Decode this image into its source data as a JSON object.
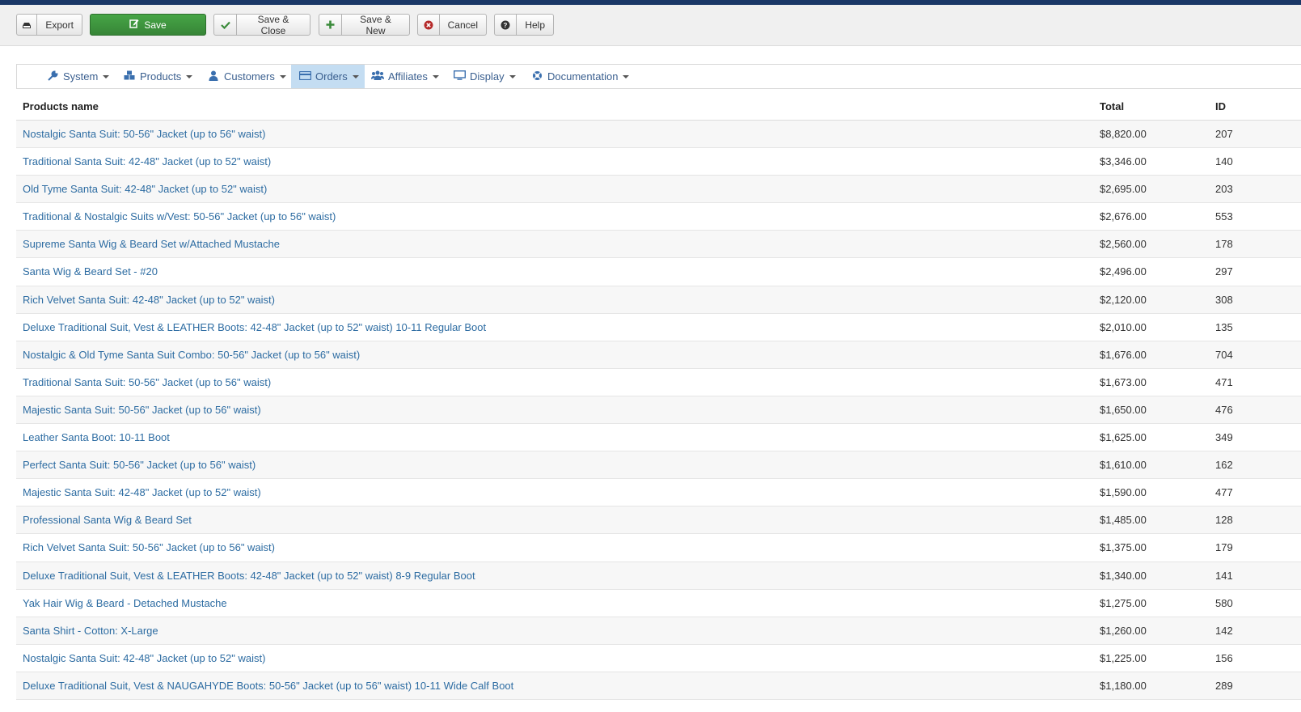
{
  "toolbar": {
    "export": "Export",
    "save": "Save",
    "save_close": "Save & Close",
    "save_new": "Save & New",
    "cancel": "Cancel",
    "help": "Help"
  },
  "menu": {
    "items": [
      {
        "label": "System",
        "icon": "wrench-icon"
      },
      {
        "label": "Products",
        "icon": "cubes-icon"
      },
      {
        "label": "Customers",
        "icon": "user-icon"
      },
      {
        "label": "Orders",
        "icon": "credit-card-icon",
        "active": true
      },
      {
        "label": "Affiliates",
        "icon": "users-icon"
      },
      {
        "label": "Display",
        "icon": "monitor-icon"
      },
      {
        "label": "Documentation",
        "icon": "lifebuoy-icon"
      }
    ]
  },
  "table": {
    "headers": {
      "name": "Products name",
      "total": "Total",
      "id": "ID"
    },
    "rows": [
      {
        "name": "Nostalgic Santa Suit: 50-56\" Jacket (up to 56\" waist)",
        "total": "$8,820.00",
        "id": "207"
      },
      {
        "name": "Traditional Santa Suit: 42-48\" Jacket (up to 52\" waist)",
        "total": "$3,346.00",
        "id": "140"
      },
      {
        "name": "Old Tyme Santa Suit: 42-48\" Jacket (up to 52\" waist)",
        "total": "$2,695.00",
        "id": "203"
      },
      {
        "name": "Traditional & Nostalgic Suits w/Vest: 50-56\" Jacket (up to 56\" waist)",
        "total": "$2,676.00",
        "id": "553"
      },
      {
        "name": "Supreme Santa Wig & Beard Set w/Attached Mustache",
        "total": "$2,560.00",
        "id": "178"
      },
      {
        "name": "Santa Wig & Beard Set - #20",
        "total": "$2,496.00",
        "id": "297"
      },
      {
        "name": "Rich Velvet Santa Suit: 42-48\" Jacket (up to 52\" waist)",
        "total": "$2,120.00",
        "id": "308"
      },
      {
        "name": "Deluxe Traditional Suit, Vest & LEATHER Boots: 42-48\" Jacket (up to 52\" waist) 10-11 Regular Boot",
        "total": "$2,010.00",
        "id": "135"
      },
      {
        "name": "Nostalgic & Old Tyme Santa Suit Combo: 50-56\" Jacket (up to 56\" waist)",
        "total": "$1,676.00",
        "id": "704"
      },
      {
        "name": "Traditional Santa Suit: 50-56\" Jacket (up to 56\" waist)",
        "total": "$1,673.00",
        "id": "471"
      },
      {
        "name": "Majestic Santa Suit: 50-56\" Jacket (up to 56\" waist)",
        "total": "$1,650.00",
        "id": "476"
      },
      {
        "name": "Leather Santa Boot: 10-11 Boot",
        "total": "$1,625.00",
        "id": "349"
      },
      {
        "name": "Perfect Santa Suit: 50-56\" Jacket (up to 56\" waist)",
        "total": "$1,610.00",
        "id": "162"
      },
      {
        "name": "Majestic Santa Suit: 42-48\" Jacket (up to 52\" waist)",
        "total": "$1,590.00",
        "id": "477"
      },
      {
        "name": "Professional Santa Wig & Beard Set",
        "total": "$1,485.00",
        "id": "128"
      },
      {
        "name": "Rich Velvet Santa Suit: 50-56\" Jacket (up to 56\" waist)",
        "total": "$1,375.00",
        "id": "179"
      },
      {
        "name": "Deluxe Traditional Suit, Vest & LEATHER Boots: 42-48\" Jacket (up to 52\" waist) 8-9 Regular Boot",
        "total": "$1,340.00",
        "id": "141"
      },
      {
        "name": "Yak Hair Wig & Beard - Detached Mustache",
        "total": "$1,275.00",
        "id": "580"
      },
      {
        "name": "Santa Shirt - Cotton: X-Large",
        "total": "$1,260.00",
        "id": "142"
      },
      {
        "name": "Nostalgic Santa Suit: 42-48\" Jacket (up to 52\" waist)",
        "total": "$1,225.00",
        "id": "156"
      },
      {
        "name": "Deluxe Traditional Suit, Vest & NAUGAHYDE Boots: 50-56\" Jacket (up to 56\" waist) 10-11 Wide Calf Boot",
        "total": "$1,180.00",
        "id": "289"
      }
    ]
  },
  "colors": {
    "accent": "#1a3867",
    "save_green": "#46a546",
    "link": "#2d6ca2",
    "active_menu": "#c4ddf2"
  }
}
